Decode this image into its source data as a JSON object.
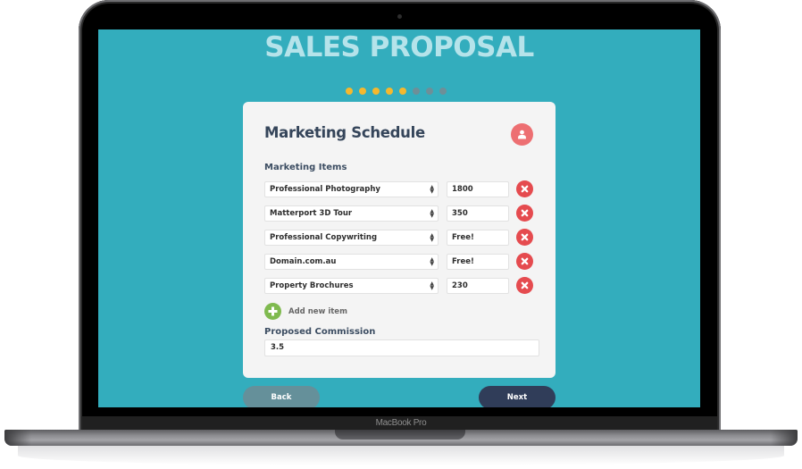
{
  "device": {
    "label": "MacBook Pro"
  },
  "page": {
    "title": "SALES PROPOSAL",
    "progress": {
      "total_steps": 8,
      "current_step": 5,
      "active_color": "#f5b82e",
      "inactive_color": "#6e8f98"
    }
  },
  "card": {
    "title": "Marketing Schedule",
    "avatar_icon": "user-icon",
    "marketing_items_label": "Marketing Items",
    "items": [
      {
        "name": "Professional Photography",
        "value": "1800"
      },
      {
        "name": "Matterport 3D Tour",
        "value": "350"
      },
      {
        "name": "Professional Copywriting",
        "value": "Free!"
      },
      {
        "name": "Domain.com.au",
        "value": "Free!"
      },
      {
        "name": "Property Brochures",
        "value": "230"
      }
    ],
    "add_item_label": "Add new item",
    "commission_label": "Proposed Commission",
    "commission_value": "3.5"
  },
  "nav": {
    "back_label": "Back",
    "next_label": "Next"
  },
  "colors": {
    "screen_bg": "#33adbd",
    "remove": "#e54b4f",
    "add": "#7fba4f",
    "avatar": "#ed6f72",
    "next": "#303d59",
    "back": "#65909a"
  }
}
